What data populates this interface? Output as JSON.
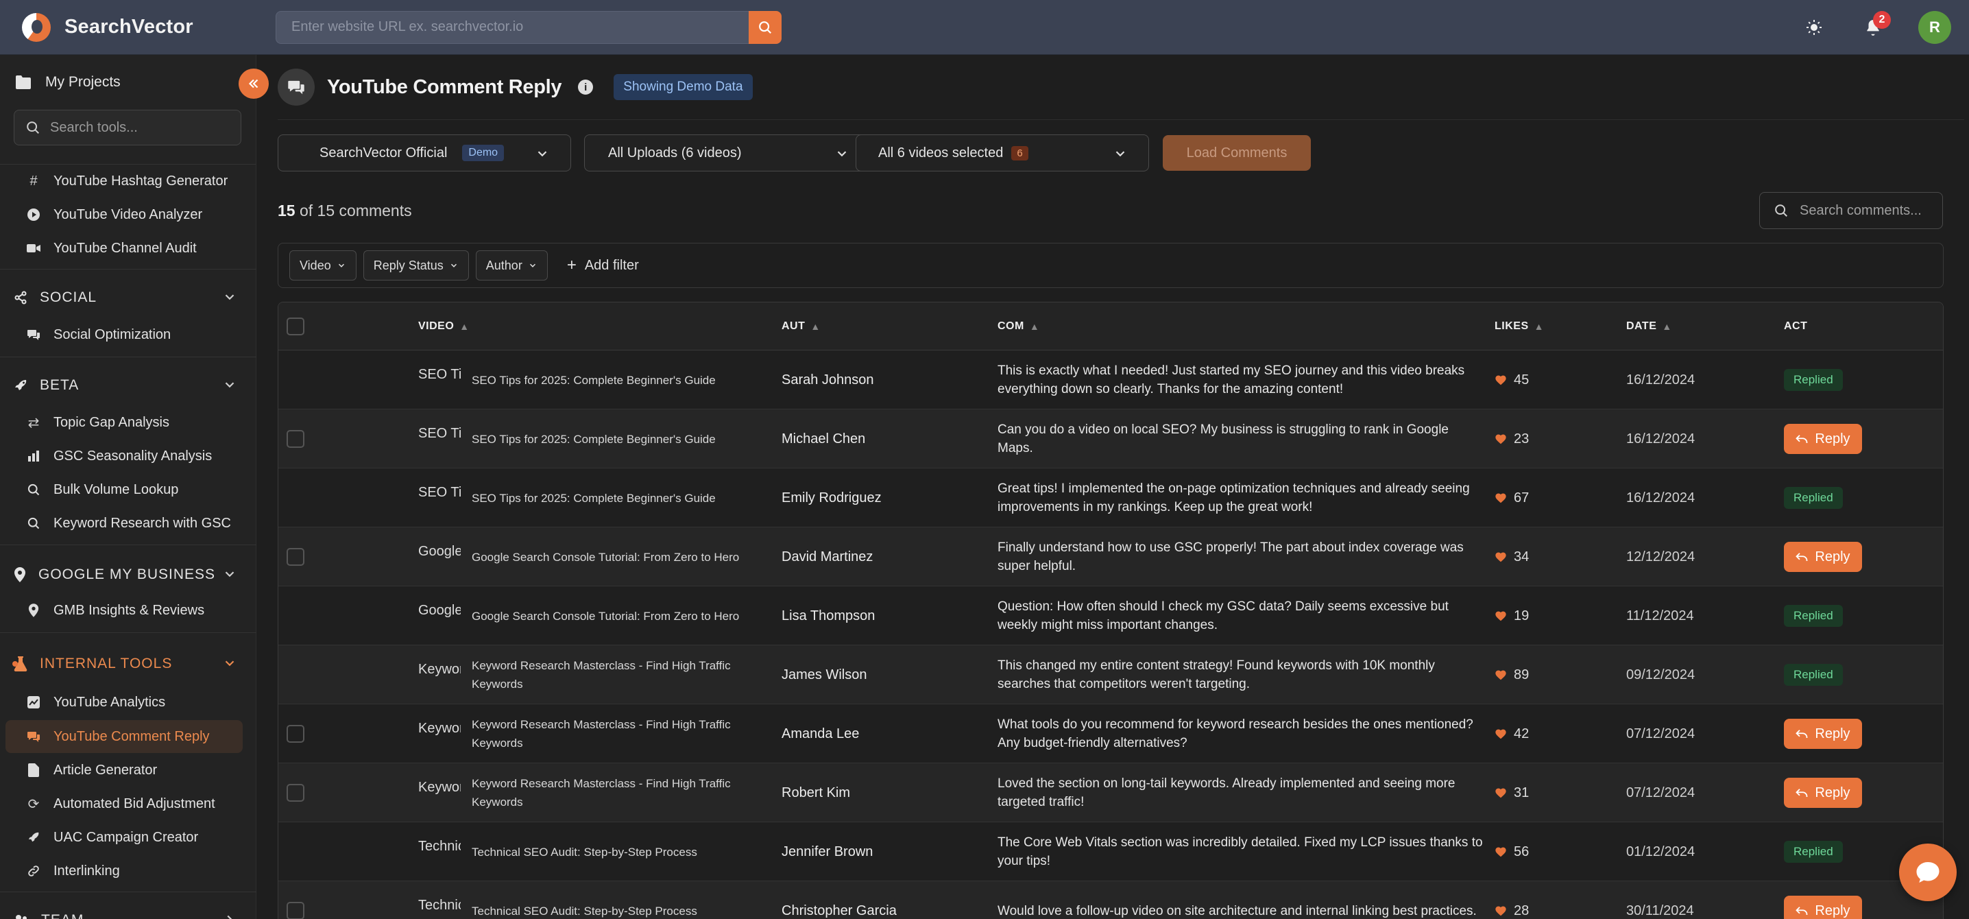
{
  "app": {
    "brand": "SearchVector",
    "url_placeholder": "Enter website URL ex. searchvector.io",
    "notifications_count": "2",
    "avatar_initial": "R",
    "accent_color": "#e8743b"
  },
  "sidebar": {
    "my_projects": "My Projects",
    "search_placeholder": "Search tools...",
    "top_items": [
      {
        "label": "YouTube Hashtag Generator",
        "icon": "hash-icon"
      },
      {
        "label": "YouTube Video Analyzer",
        "icon": "play-circle-icon"
      },
      {
        "label": "YouTube Channel Audit",
        "icon": "video-camera-icon"
      }
    ],
    "sections": {
      "social": {
        "title": "SOCIAL",
        "items": [
          "Social Optimization"
        ]
      },
      "beta": {
        "title": "BETA",
        "items": [
          "Topic Gap Analysis",
          "GSC Seasonality Analysis",
          "Bulk Volume Lookup",
          "Keyword Research with GSC"
        ]
      },
      "gmb": {
        "title": "GOOGLE MY BUSINESS",
        "items": [
          "GMB Insights & Reviews"
        ]
      },
      "internal": {
        "title": "INTERNAL TOOLS",
        "items": [
          "YouTube Analytics",
          "YouTube Comment Reply",
          "Article Generator",
          "Automated Bid Adjustment",
          "UAC Campaign Creator",
          "Interlinking"
        ]
      },
      "team": {
        "title": "TEAM"
      }
    },
    "active_item": "YouTube Comment Reply"
  },
  "main": {
    "title": "YouTube Comment Reply",
    "demo_label": "Showing Demo Data",
    "channel_select": {
      "value": "SearchVector Official",
      "badge": "Demo"
    },
    "uploads_select": {
      "value": "All Uploads (6 videos)"
    },
    "videos_select": {
      "value": "All 6 videos selected",
      "count": "6"
    },
    "load_button": "Load Comments",
    "count_shown": "15",
    "count_total_text": "of 15 comments",
    "comment_search_placeholder": "Search comments...",
    "filters": [
      "Video",
      "Reply Status",
      "Author"
    ],
    "add_filter": "Add filter"
  },
  "table": {
    "columns": {
      "video": "VIDEO",
      "author": "AUT",
      "comment": "COM",
      "likes": "LIKES",
      "date": "DATE",
      "actions": "ACT"
    },
    "reply_label": "Reply",
    "replied_label": "Replied",
    "rows": [
      {
        "thumb_alt": "SEO Tips for",
        "video": "SEO Tips for 2025: Complete Beginner's Guide",
        "author": "Sarah Johnson",
        "comment": "This is exactly what I needed! Just started my SEO journey and this video breaks everything down so clearly. Thanks for the amazing content!",
        "likes": "45",
        "date": "16/12/2024",
        "status": "replied"
      },
      {
        "thumb_alt": "SEO Tips for",
        "video": "SEO Tips for 2025: Complete Beginner's Guide",
        "author": "Michael Chen",
        "comment": "Can you do a video on local SEO? My business is struggling to rank in Google Maps.",
        "likes": "23",
        "date": "16/12/2024",
        "status": "reply"
      },
      {
        "thumb_alt": "SEO Tips",
        "video": "SEO Tips for 2025: Complete Beginner's Guide",
        "author": "Emily Rodriguez",
        "comment": "Great tips! I implemented the on-page optimization techniques and already seeing improvements in my rankings. Keep up the great work!",
        "likes": "67",
        "date": "16/12/2024",
        "status": "replied"
      },
      {
        "thumb_alt": "Google",
        "video": "Google Search Console Tutorial: From Zero to Hero",
        "author": "David Martinez",
        "comment": "Finally understand how to use GSC properly! The part about index coverage was super helpful.",
        "likes": "34",
        "date": "12/12/2024",
        "status": "reply"
      },
      {
        "thumb_alt": "Google",
        "video": "Google Search Console Tutorial: From Zero to Hero",
        "author": "Lisa Thompson",
        "comment": "Question: How often should I check my GSC data? Daily seems excessive but weekly might miss important changes.",
        "likes": "19",
        "date": "11/12/2024",
        "status": "replied"
      },
      {
        "thumb_alt": "Keyword",
        "video": "Keyword Research Masterclass - Find High Traffic Keywords",
        "author": "James Wilson",
        "comment": "This changed my entire content strategy! Found keywords with 10K monthly searches that competitors weren't targeting.",
        "likes": "89",
        "date": "09/12/2024",
        "status": "replied"
      },
      {
        "thumb_alt": "Keyword",
        "video": "Keyword Research Masterclass - Find High Traffic Keywords",
        "author": "Amanda Lee",
        "comment": "What tools do you recommend for keyword research besides the ones mentioned? Any budget-friendly alternatives?",
        "likes": "42",
        "date": "07/12/2024",
        "status": "reply"
      },
      {
        "thumb_alt": "Keyword",
        "video": "Keyword Research Masterclass - Find High Traffic Keywords",
        "author": "Robert Kim",
        "comment": "Loved the section on long-tail keywords. Already implemented and seeing more targeted traffic!",
        "likes": "31",
        "date": "07/12/2024",
        "status": "reply"
      },
      {
        "thumb_alt": "Technical",
        "video": "Technical SEO Audit: Step-by-Step Process",
        "author": "Jennifer Brown",
        "comment": "The Core Web Vitals section was incredibly detailed. Fixed my LCP issues thanks to your tips!",
        "likes": "56",
        "date": "01/12/2024",
        "status": "replied"
      },
      {
        "thumb_alt": "Technical",
        "video": "Technical SEO Audit: Step-by-Step Process",
        "author": "Christopher Garcia",
        "comment": "Would love a follow-up video on site architecture and internal linking best practices.",
        "likes": "28",
        "date": "30/11/2024",
        "status": "reply"
      }
    ]
  }
}
